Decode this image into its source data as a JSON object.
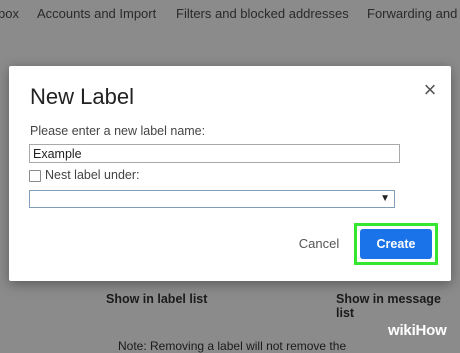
{
  "settings_tabs": [
    {
      "label": "box"
    },
    {
      "label": "Accounts and Import"
    },
    {
      "label": "Filters and blocked addresses"
    },
    {
      "label": "Forwarding and"
    }
  ],
  "background": {
    "show_in_label_list": "Show in label list",
    "show_in_message_list": "Show in message list",
    "note_fragment": "Note: Removing a label will not remove the"
  },
  "dialog": {
    "title": "New Label",
    "close_glyph": "×",
    "prompt": "Please enter a new label name:",
    "name_value": "Example",
    "nest_label": "Nest label under:",
    "nest_checked": false,
    "parent_select_value": "",
    "select_arrow_glyph": "▼",
    "cancel_label": "Cancel",
    "create_label": "Create"
  },
  "colors": {
    "overlay": "#8b8b8b",
    "primary_button": "#1a73e8",
    "highlight_outline": "#35e62e"
  },
  "watermark": {
    "part1": "wiki",
    "part2": "How"
  }
}
